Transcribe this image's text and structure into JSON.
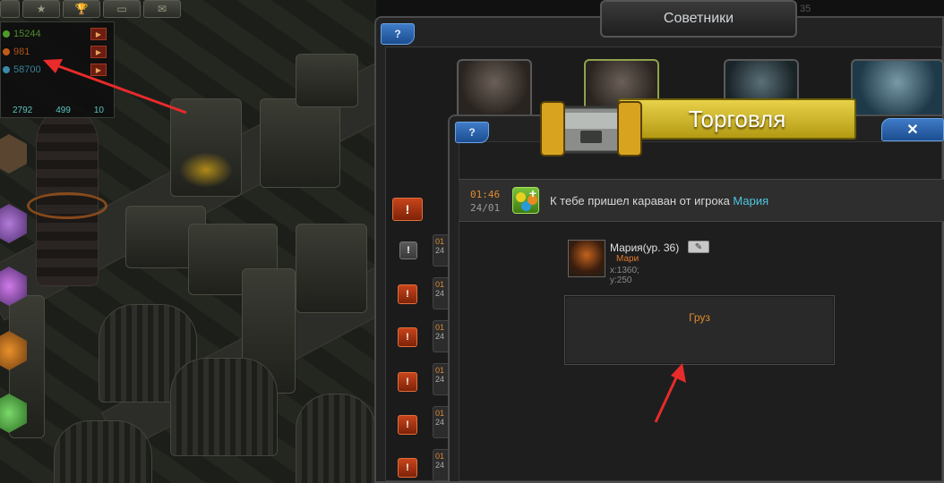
{
  "resources": {
    "top_tabs": [
      "",
      "★",
      "🏆",
      "▭",
      "✉"
    ],
    "items": [
      {
        "value": "15244",
        "color": "#4e9a2a",
        "text_color": "#4f8a2c"
      },
      {
        "value": "981",
        "color": "#c05a18",
        "text_color": "#b0511a"
      },
      {
        "value": "58700",
        "color": "#3a8aa8",
        "text_color": "#3c7f9a"
      }
    ],
    "stats": [
      "2792",
      "499",
      "10"
    ]
  },
  "advisors": {
    "title": "Советники",
    "help_label": "?",
    "partial_counter": "35",
    "alert_label": "!",
    "list_time_prefix": "01",
    "list_date_prefix": "24"
  },
  "trade": {
    "title": "Торговля",
    "help_label": "?",
    "close_label": "✕",
    "message": {
      "time": "01:46",
      "date": "24/01",
      "text": "К тебе пришел караван от игрока",
      "player_link": "Мария"
    },
    "player": {
      "name": "Мария(ур. 36)",
      "alliance": "Мари",
      "coords": "x:1360; y:250",
      "edit_icon": "✎"
    },
    "cargo_label": "Груз"
  },
  "annotation_color": "#e82b2b"
}
